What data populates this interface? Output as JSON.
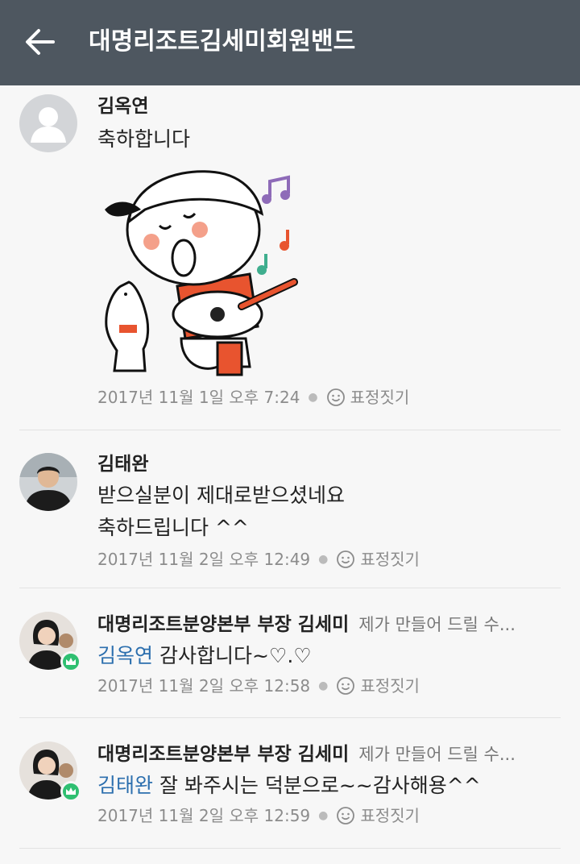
{
  "header": {
    "title": "대명리조트김세미회원밴드"
  },
  "comments": [
    {
      "name": "김옥연",
      "subtitle": "",
      "mention": "",
      "text": "축하합니다",
      "date": "2017년 11월 1일 오후 7:24",
      "react_label": "표정짓기",
      "has_sticker": true
    },
    {
      "name": "김태완",
      "subtitle": "",
      "mention": "",
      "text": "받으실분이 제대로받으셨네요",
      "text2": "축하드립니다 ^^",
      "date": "2017년 11월 2일 오후 12:49",
      "react_label": "표정짓기"
    },
    {
      "name": "대명리조트분양본부 부장 김세미",
      "subtitle": "제가 만들어 드릴 수...",
      "mention": "김옥연",
      "text": " 감사합니다~♡.♡",
      "date": "2017년 11월 2일 오후 12:58",
      "react_label": "표정짓기",
      "badge": "crown-badge"
    },
    {
      "name": "대명리조트분양본부 부장 김세미",
      "subtitle": "제가 만들어 드릴 수...",
      "mention": "김태완",
      "text": " 잘 봐주시는 덕분으로~~감사해용^^",
      "date": "2017년 11월 2일 오후 12:59",
      "react_label": "표정짓기",
      "badge": "crown-badge"
    }
  ],
  "colors": {
    "header_bg": "#4e5760",
    "mention": "#2c6fae",
    "badge": "#2fbf71",
    "meta": "#8c8c8c"
  }
}
